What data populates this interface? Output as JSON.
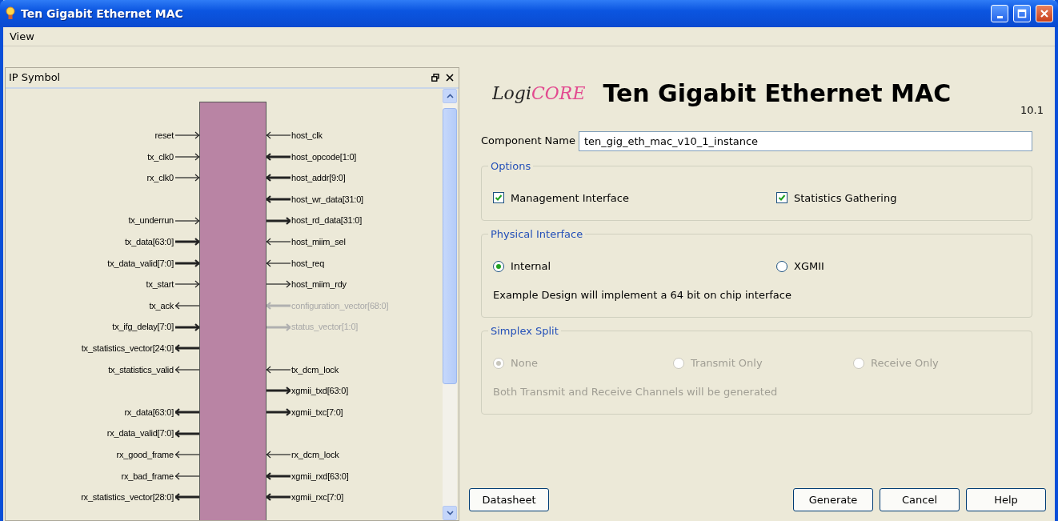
{
  "window": {
    "title": "Ten Gigabit Ethernet MAC"
  },
  "menu": [
    "View"
  ],
  "ip_symbol_panel": {
    "title": "IP Symbol",
    "left_pins": [
      {
        "kind": "pin",
        "name": "reset",
        "input": true,
        "bus": false,
        "disabled": false
      },
      {
        "kind": "pin",
        "name": "tx_clk0",
        "input": true,
        "bus": false,
        "disabled": false
      },
      {
        "kind": "pin",
        "name": "rx_clk0",
        "input": true,
        "bus": false,
        "disabled": false
      },
      {
        "kind": "gap"
      },
      {
        "kind": "pin",
        "name": "tx_underrun",
        "input": true,
        "bus": false,
        "disabled": false
      },
      {
        "kind": "pin",
        "name": "tx_data[63:0]",
        "input": true,
        "bus": true,
        "disabled": false
      },
      {
        "kind": "pin",
        "name": "tx_data_valid[7:0]",
        "input": true,
        "bus": true,
        "disabled": false
      },
      {
        "kind": "pin",
        "name": "tx_start",
        "input": true,
        "bus": false,
        "disabled": false
      },
      {
        "kind": "pin",
        "name": "tx_ack",
        "input": false,
        "bus": false,
        "disabled": false
      },
      {
        "kind": "pin",
        "name": "tx_ifg_delay[7:0]",
        "input": true,
        "bus": true,
        "disabled": false
      },
      {
        "kind": "pin",
        "name": "tx_statistics_vector[24:0]",
        "input": false,
        "bus": true,
        "disabled": false
      },
      {
        "kind": "pin",
        "name": "tx_statistics_valid",
        "input": false,
        "bus": false,
        "disabled": false
      },
      {
        "kind": "gap"
      },
      {
        "kind": "pin",
        "name": "rx_data[63:0]",
        "input": false,
        "bus": true,
        "disabled": false
      },
      {
        "kind": "pin",
        "name": "rx_data_valid[7:0]",
        "input": false,
        "bus": true,
        "disabled": false
      },
      {
        "kind": "pin",
        "name": "rx_good_frame",
        "input": false,
        "bus": false,
        "disabled": false
      },
      {
        "kind": "pin",
        "name": "rx_bad_frame",
        "input": false,
        "bus": false,
        "disabled": false
      },
      {
        "kind": "pin",
        "name": "rx_statistics_vector[28:0]",
        "input": false,
        "bus": true,
        "disabled": false
      }
    ],
    "right_pins": [
      {
        "kind": "pin",
        "name": "host_clk",
        "input": true,
        "bus": false,
        "disabled": false
      },
      {
        "kind": "pin",
        "name": "host_opcode[1:0]",
        "input": true,
        "bus": true,
        "disabled": false
      },
      {
        "kind": "pin",
        "name": "host_addr[9:0]",
        "input": true,
        "bus": true,
        "disabled": false
      },
      {
        "kind": "pin",
        "name": "host_wr_data[31:0]",
        "input": true,
        "bus": true,
        "disabled": false
      },
      {
        "kind": "pin",
        "name": "host_rd_data[31:0]",
        "input": false,
        "bus": true,
        "disabled": false
      },
      {
        "kind": "pin",
        "name": "host_miim_sel",
        "input": true,
        "bus": false,
        "disabled": false
      },
      {
        "kind": "pin",
        "name": "host_req",
        "input": true,
        "bus": false,
        "disabled": false
      },
      {
        "kind": "pin",
        "name": "host_miim_rdy",
        "input": false,
        "bus": false,
        "disabled": false
      },
      {
        "kind": "pin",
        "name": "configuration_vector[68:0]",
        "input": true,
        "bus": true,
        "disabled": true
      },
      {
        "kind": "pin",
        "name": "status_vector[1:0]",
        "input": false,
        "bus": true,
        "disabled": true
      },
      {
        "kind": "gap"
      },
      {
        "kind": "pin",
        "name": "tx_dcm_lock",
        "input": true,
        "bus": false,
        "disabled": false
      },
      {
        "kind": "pin",
        "name": "xgmii_txd[63:0]",
        "input": false,
        "bus": true,
        "disabled": false
      },
      {
        "kind": "pin",
        "name": "xgmii_txc[7:0]",
        "input": false,
        "bus": true,
        "disabled": false
      },
      {
        "kind": "gap"
      },
      {
        "kind": "pin",
        "name": "rx_dcm_lock",
        "input": true,
        "bus": false,
        "disabled": false
      },
      {
        "kind": "pin",
        "name": "xgmii_rxd[63:0]",
        "input": true,
        "bus": true,
        "disabled": false
      },
      {
        "kind": "pin",
        "name": "xgmii_rxc[7:0]",
        "input": true,
        "bus": true,
        "disabled": false
      }
    ]
  },
  "header": {
    "logo": "LogiCORE",
    "title": "Ten Gigabit Ethernet MAC",
    "version": "10.1"
  },
  "component_name": {
    "label": "Component Name",
    "value": "ten_gig_eth_mac_v10_1_instance"
  },
  "groups": [
    {
      "legend": "Options",
      "kind": "checkboxes",
      "disabled": false,
      "items": [
        {
          "label": "Management Interface",
          "checked": true
        },
        {
          "label": "Statistics Gathering",
          "checked": true
        }
      ]
    },
    {
      "legend": "Physical Interface",
      "kind": "radios",
      "disabled": false,
      "items": [
        {
          "label": "Internal",
          "selected": true
        },
        {
          "label": "XGMII",
          "selected": false
        }
      ],
      "note": "Example Design will implement a 64 bit on chip interface"
    },
    {
      "legend": "Simplex Split",
      "kind": "radios",
      "disabled": true,
      "items": [
        {
          "label": "None",
          "selected": true
        },
        {
          "label": "Transmit Only",
          "selected": false
        },
        {
          "label": "Receive Only",
          "selected": false
        }
      ],
      "note": "Both Transmit and Receive Channels will be generated"
    }
  ],
  "buttons_left": [
    "Datasheet"
  ],
  "buttons_right": [
    "Generate",
    "Cancel",
    "Help"
  ]
}
